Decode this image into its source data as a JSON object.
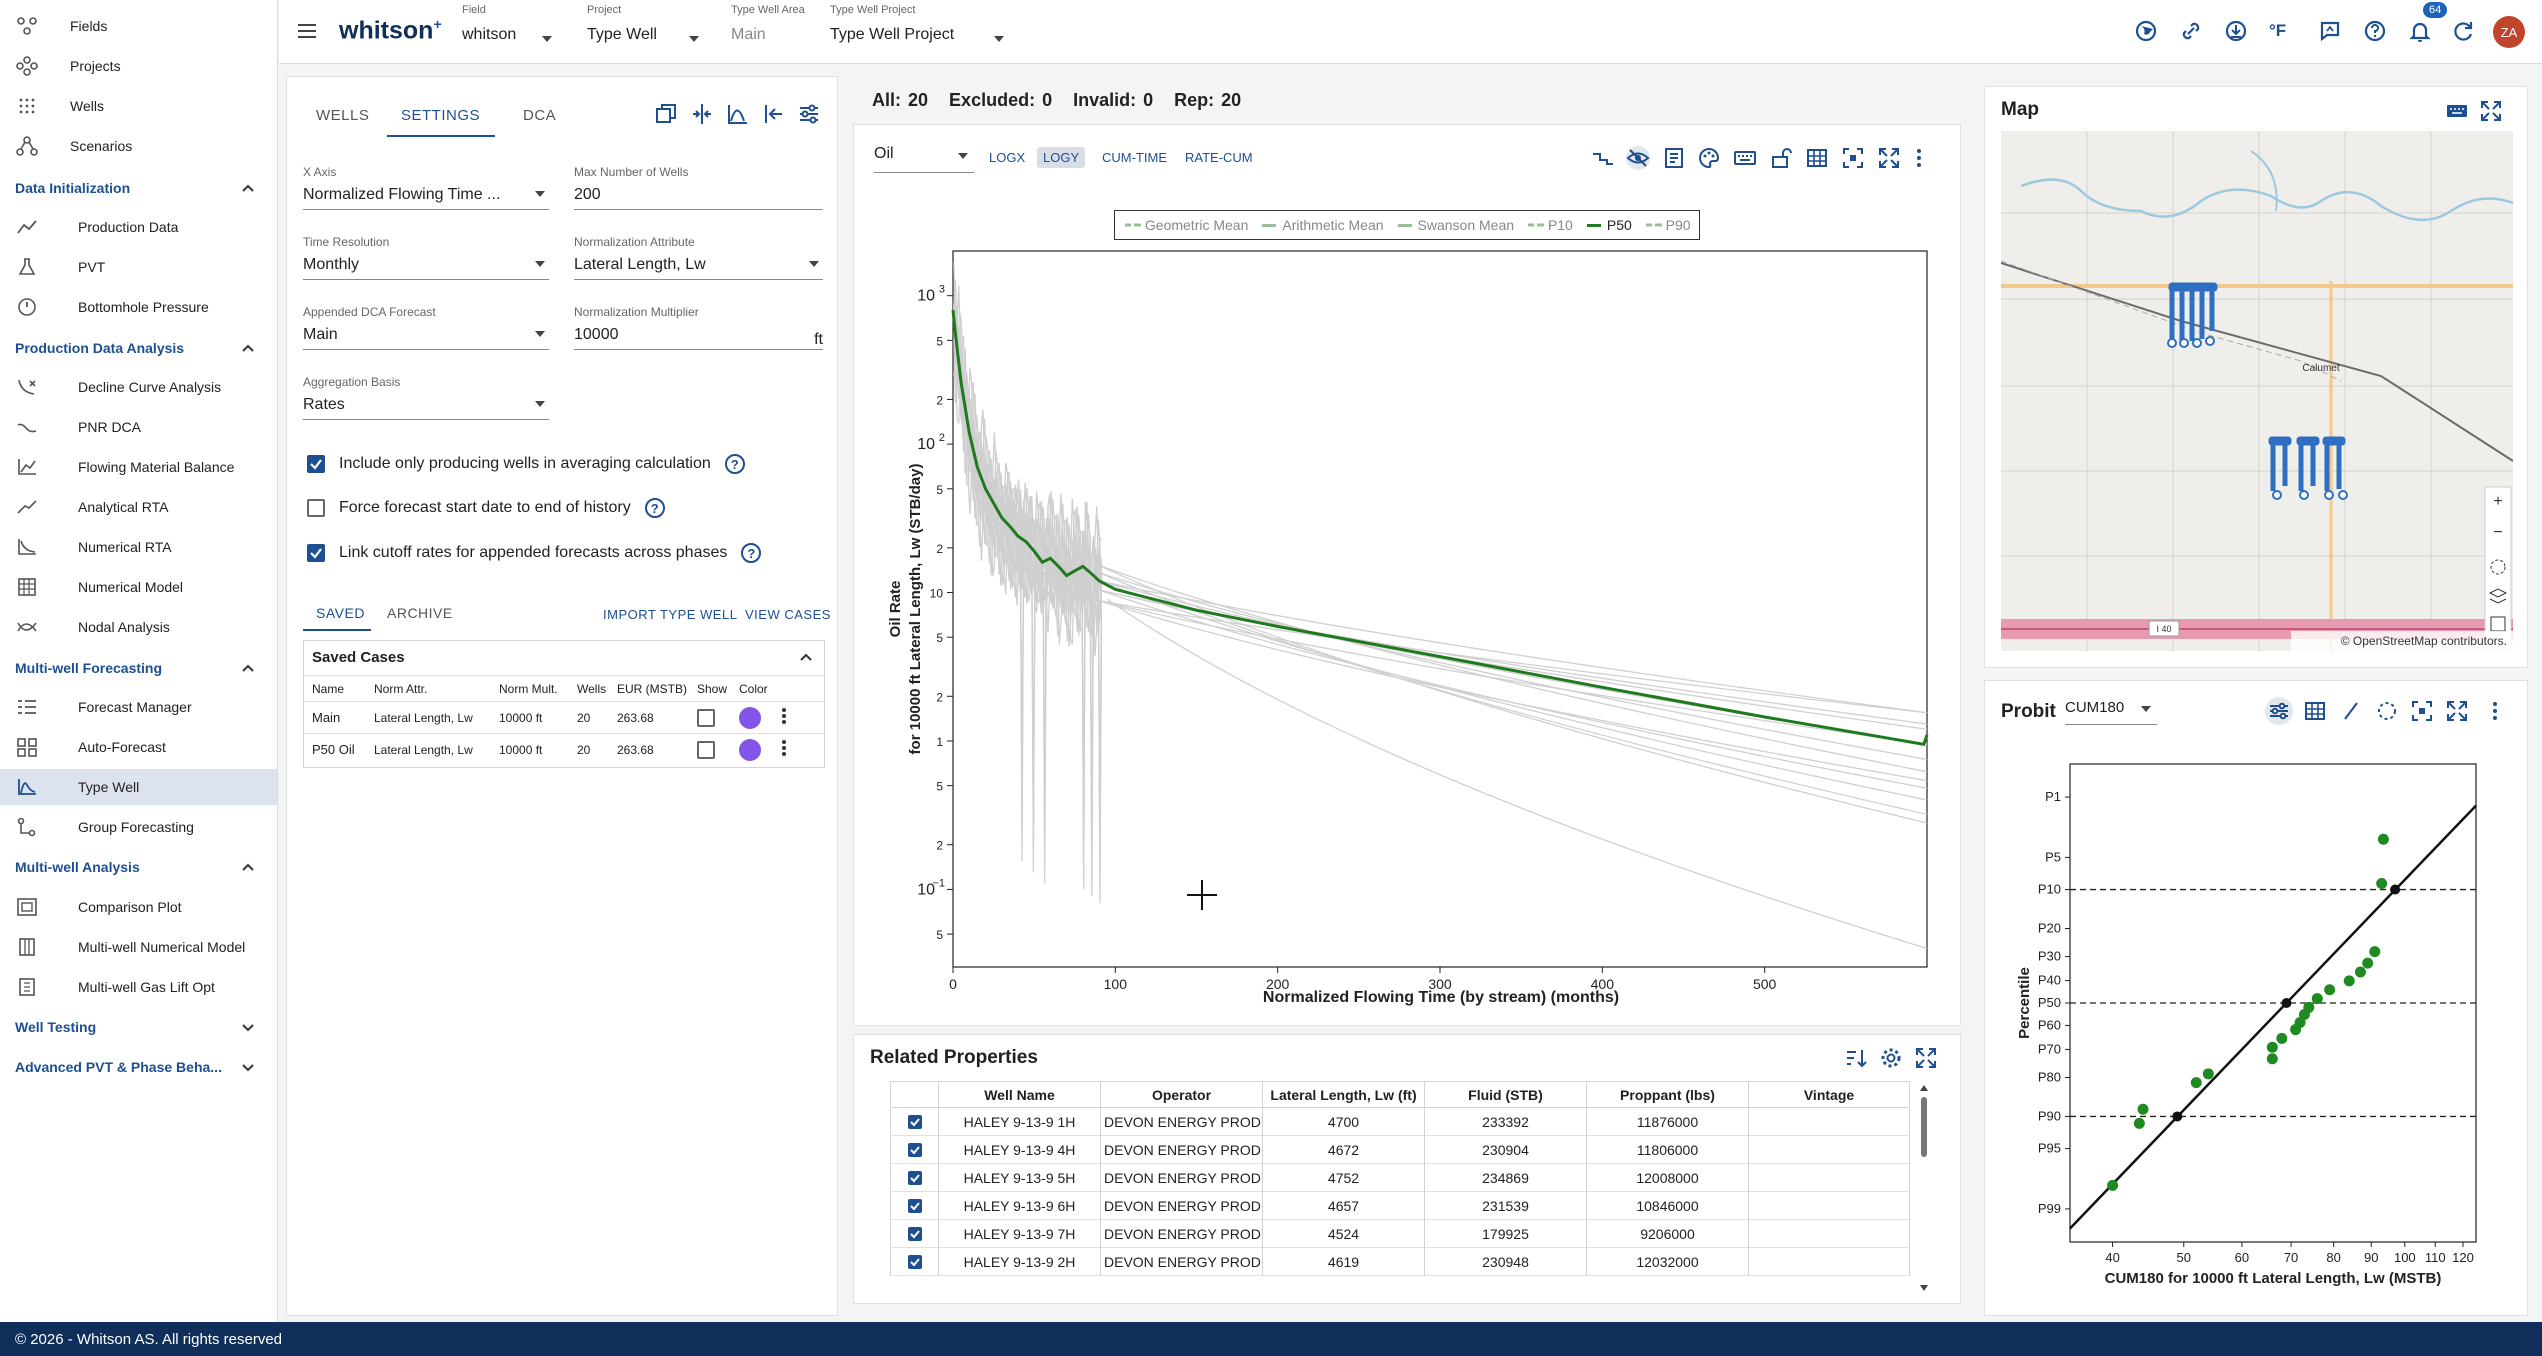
{
  "sidebar": {
    "top_items": [
      {
        "label": "Fields",
        "icon": "fields-icon"
      },
      {
        "label": "Projects",
        "icon": "projects-icon"
      },
      {
        "label": "Wells",
        "icon": "wells-icon"
      },
      {
        "label": "Scenarios",
        "icon": "scenarios-icon"
      }
    ],
    "sections": [
      {
        "label": "Data Initialization",
        "expanded": true,
        "items": [
          {
            "label": "Production Data",
            "icon": "production-data-icon"
          },
          {
            "label": "PVT",
            "icon": "pvt-flask-icon"
          },
          {
            "label": "Bottomhole Pressure",
            "icon": "gauge-icon"
          }
        ]
      },
      {
        "label": "Production Data Analysis",
        "expanded": true,
        "items": [
          {
            "label": "Decline Curve Analysis",
            "icon": "decline-curve-icon"
          },
          {
            "label": "PNR DCA",
            "icon": "pnr-dca-icon"
          },
          {
            "label": "Flowing Material Balance",
            "icon": "fmb-chart-icon"
          },
          {
            "label": "Analytical RTA",
            "icon": "analytical-rta-icon"
          },
          {
            "label": "Numerical RTA",
            "icon": "numerical-rta-icon"
          },
          {
            "label": "Numerical Model",
            "icon": "numerical-model-icon"
          },
          {
            "label": "Nodal Analysis",
            "icon": "nodal-analysis-icon"
          }
        ]
      },
      {
        "label": "Multi-well Forecasting",
        "expanded": true,
        "items": [
          {
            "label": "Forecast Manager",
            "icon": "forecast-manager-icon"
          },
          {
            "label": "Auto-Forecast",
            "icon": "auto-forecast-icon"
          },
          {
            "label": "Type Well",
            "icon": "type-well-icon",
            "active": true
          },
          {
            "label": "Group Forecasting",
            "icon": "group-forecasting-icon"
          }
        ]
      },
      {
        "label": "Multi-well Analysis",
        "expanded": true,
        "items": [
          {
            "label": "Comparison Plot",
            "icon": "comparison-plot-icon"
          },
          {
            "label": "Multi-well Numerical Model",
            "icon": "multiwell-model-icon"
          },
          {
            "label": "Multi-well Gas Lift Opt",
            "icon": "gas-lift-icon"
          }
        ]
      },
      {
        "label": "Well Testing",
        "expanded": false,
        "items": []
      },
      {
        "label": "Advanced PVT & Phase Beha...",
        "expanded": false,
        "items": []
      }
    ]
  },
  "footer": {
    "text": "© 2026 - Whitson AS. All rights reserved"
  },
  "header": {
    "logo": "whitson",
    "logo_sup": "+",
    "field": {
      "caption": "Field",
      "value": "whitson"
    },
    "project": {
      "caption": "Project",
      "value": "Type Well"
    },
    "type_well_area": {
      "caption": "Type Well Area",
      "value": "Main"
    },
    "type_well_project": {
      "caption": "Type Well Project",
      "value": "Type Well Project"
    },
    "notification_count": "64",
    "avatar": "ZA",
    "unit_label": "°F"
  },
  "settings": {
    "tabs": [
      "WELLS",
      "SETTINGS",
      "DCA"
    ],
    "active_tab": "SETTINGS",
    "fields": {
      "x_axis": {
        "caption": "X Axis",
        "value": "Normalized Flowing Time ..."
      },
      "max_wells": {
        "caption": "Max Number of Wells",
        "value": "200"
      },
      "time_resolution": {
        "caption": "Time Resolution",
        "value": "Monthly"
      },
      "norm_attr": {
        "caption": "Normalization Attribute",
        "value": "Lateral Length, Lw"
      },
      "appended_dca": {
        "caption": "Appended DCA Forecast",
        "value": "Main"
      },
      "norm_mult": {
        "caption": "Normalization Multiplier",
        "value": "10000",
        "unit": "ft"
      },
      "agg_basis": {
        "caption": "Aggregation Basis",
        "value": "Rates"
      }
    },
    "checkboxes": [
      {
        "label": "Include only producing wells in averaging calculation",
        "checked": true
      },
      {
        "label": "Force forecast start date to end of history",
        "checked": false
      },
      {
        "label": "Link cutoff rates for appended forecasts across phases",
        "checked": true
      }
    ],
    "case_tabs": [
      "SAVED",
      "ARCHIVE"
    ],
    "import_label": "IMPORT TYPE WELL",
    "view_label": "VIEW CASES",
    "saved_title": "Saved Cases",
    "columns": [
      "Name",
      "Norm Attr.",
      "Norm Mult.",
      "Wells",
      "EUR (MSTB)",
      "Show",
      "Color"
    ],
    "rows": [
      {
        "name": "Main",
        "norm_attr": "Lateral Length, Lw",
        "norm_mult": "10000 ft",
        "wells": "20",
        "eur": "263.68",
        "color": "#8155e6"
      },
      {
        "name": "P50 Oil",
        "norm_attr": "Lateral Length, Lw",
        "norm_mult": "10000 ft",
        "wells": "20",
        "eur": "263.68",
        "color": "#8155e6"
      }
    ]
  },
  "stats": {
    "all": "All: 20",
    "excluded": "Excluded: 0",
    "invalid": "Invalid: 0",
    "rep": "Rep: 20"
  },
  "plot_controls": {
    "phase": "Oil",
    "buttons": [
      "LOGX",
      "LOGY",
      "CUM-TIME",
      "RATE-CUM"
    ],
    "active": "LOGY"
  },
  "chart_data": [
    {
      "type": "line",
      "legend_placement": "top",
      "legend": [
        "Geometric Mean",
        "Arithmetic Mean",
        "Swanson Mean",
        "P10",
        "P50",
        "P90"
      ],
      "xlabel": "Normalized Flowing Time (by stream) (months)",
      "ylabel_line1": "Oil Rate",
      "ylabel_line2": "for 10000 ft Lateral Length, Lw (STB/day)",
      "xlim": [
        0,
        600
      ],
      "ylim": [
        0.03,
        2000
      ],
      "log_y": true,
      "x_ticks": [
        "0",
        "100",
        "200",
        "300",
        "400",
        "500"
      ],
      "y_ticks": [
        {
          "v": 1000,
          "label": "10",
          "exp": "3"
        },
        {
          "v": 500,
          "label": "5"
        },
        {
          "v": 200,
          "label": "2"
        },
        {
          "v": 100,
          "label": "10",
          "exp": "2"
        },
        {
          "v": 50,
          "label": "5"
        },
        {
          "v": 20,
          "label": "2"
        },
        {
          "v": 10,
          "label": "10"
        },
        {
          "v": 5,
          "label": "5"
        },
        {
          "v": 2,
          "label": "2"
        },
        {
          "v": 1,
          "label": "1"
        },
        {
          "v": 0.5,
          "label": "5"
        },
        {
          "v": 0.2,
          "label": "2"
        },
        {
          "v": 0.1,
          "label": "10",
          "exp": "−1"
        },
        {
          "v": 0.05,
          "label": "5"
        }
      ],
      "p50_series": {
        "name": "P50",
        "color": "#1f7a1f",
        "x": [
          0,
          2,
          5,
          10,
          15,
          20,
          25,
          30,
          35,
          40,
          45,
          50,
          55,
          60,
          65,
          70,
          75,
          80,
          85,
          90,
          100,
          150,
          200,
          300,
          400,
          500,
          598
        ],
        "y": [
          800,
          500,
          260,
          120,
          70,
          50,
          40,
          32,
          28,
          24,
          22,
          19,
          16,
          17,
          15,
          13,
          14,
          15,
          13.5,
          12,
          10.5,
          7.6,
          5.9,
          3.7,
          2.3,
          1.45,
          0.95
        ]
      },
      "well_decline_endpoints": [
        1.55,
        1.2,
        0.95,
        0.75,
        0.62,
        0.54,
        0.48,
        0.4,
        0.32,
        0.28,
        0.95,
        1.3,
        1.55
      ],
      "lowest_curve_end": 0.04
    },
    {
      "type": "scatter",
      "title": "Probit",
      "xlabel": "CUM180 for 10000 ft Lateral Length, Lw (MSTB)",
      "ylabel": "Percentile",
      "xlim": [
        35,
        125
      ],
      "x_log": true,
      "x_ticks": [
        40,
        50,
        60,
        70,
        80,
        90,
        100,
        110,
        120
      ],
      "y_ticks": [
        "P1",
        "P5",
        "P10",
        "P20",
        "P30",
        "P40",
        "P50",
        "P60",
        "P70",
        "P80",
        "P90",
        "P95",
        "P99"
      ],
      "y_tick_z": [
        2.326,
        1.645,
        1.2816,
        0.8416,
        0.5244,
        0.2533,
        0,
        -0.2533,
        -0.5244,
        -0.8416,
        -1.2816,
        -1.645,
        -2.326
      ],
      "dashed_lines": [
        "P10",
        "P50",
        "P90"
      ],
      "points": [
        [
          40,
          -2.06
        ],
        [
          43.5,
          -1.36
        ],
        [
          44,
          -1.2
        ],
        [
          52,
          -0.9
        ],
        [
          54,
          -0.8
        ],
        [
          66,
          -0.63
        ],
        [
          66,
          -0.5
        ],
        [
          68,
          -0.4
        ],
        [
          71,
          -0.3
        ],
        [
          72,
          -0.22
        ],
        [
          73,
          -0.13
        ],
        [
          74,
          -0.05
        ],
        [
          76,
          0.05
        ],
        [
          79,
          0.15
        ],
        [
          84,
          0.25
        ],
        [
          87,
          0.35
        ],
        [
          89,
          0.45
        ],
        [
          91,
          0.58
        ],
        [
          93,
          1.35
        ],
        [
          93.5,
          1.85
        ]
      ],
      "fit_points": [
        [
          49,
          -1.2816
        ],
        [
          69,
          0
        ],
        [
          97,
          1.2816
        ]
      ]
    }
  ],
  "map": {
    "title": "Map",
    "label_town": "Calumet",
    "label_road": "I 40",
    "attribution": "© OpenStreetMap contributors."
  },
  "probit": {
    "title": "Probit",
    "selector": "CUM180"
  },
  "related": {
    "title": "Related Properties",
    "columns": [
      "Well Name",
      "Operator",
      "Lateral Length, Lw (ft)",
      "Fluid (STB)",
      "Proppant (lbs)",
      "Vintage"
    ],
    "rows": [
      [
        "HALEY 9-13-9 1H",
        "DEVON ENERGY PRODUC",
        "4700",
        "233392",
        "11876000",
        ""
      ],
      [
        "HALEY 9-13-9 4H",
        "DEVON ENERGY PRODUC",
        "4672",
        "230904",
        "11806000",
        ""
      ],
      [
        "HALEY 9-13-9 5H",
        "DEVON ENERGY PRODUC",
        "4752",
        "234869",
        "12008000",
        ""
      ],
      [
        "HALEY 9-13-9 6H",
        "DEVON ENERGY PRODUC",
        "4657",
        "231539",
        "10846000",
        ""
      ],
      [
        "HALEY 9-13-9 7H",
        "DEVON ENERGY PRODUC",
        "4524",
        "179925",
        "9206000",
        ""
      ],
      [
        "HALEY 9-13-9 2H",
        "DEVON ENERGY PRODUC",
        "4619",
        "230948",
        "12032000",
        ""
      ]
    ]
  }
}
